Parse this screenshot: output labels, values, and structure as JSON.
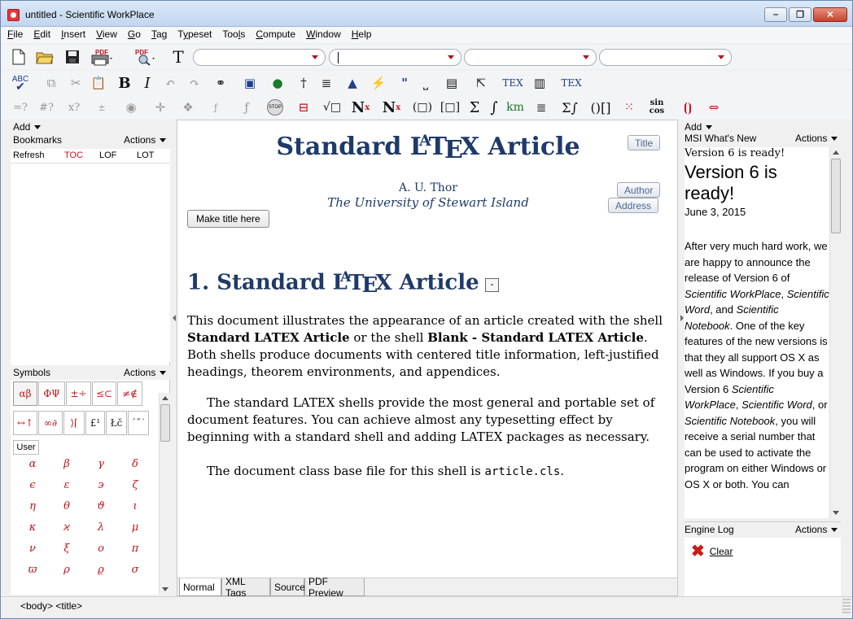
{
  "window": {
    "title": "untitled - Scientific WorkPlace"
  },
  "menu": [
    {
      "pre": "",
      "u": "F",
      "post": "ile"
    },
    {
      "pre": "",
      "u": "E",
      "post": "dit"
    },
    {
      "pre": "",
      "u": "I",
      "post": "nsert"
    },
    {
      "pre": "",
      "u": "V",
      "post": "iew"
    },
    {
      "pre": "",
      "u": "G",
      "post": "o"
    },
    {
      "pre": "",
      "u": "T",
      "post": "ag"
    },
    {
      "pre": "T",
      "u": "y",
      "post": "peset"
    },
    {
      "pre": "Too",
      "u": "l",
      "post": "s"
    },
    {
      "pre": "",
      "u": "C",
      "post": "ompute"
    },
    {
      "pre": "",
      "u": "W",
      "post": "indow"
    },
    {
      "pre": "",
      "u": "H",
      "post": "elp"
    }
  ],
  "toolbar": {
    "pdf_label": "PDF",
    "pdf_label2": "PDF",
    "font_T": "T",
    "spell_label": "ABC",
    "bold": "B",
    "italic": "I",
    "tex1": "TEX",
    "tex2": "TEX",
    "quote": "\"",
    "eval1": "=?",
    "eval2": "#?",
    "eval3": "x?",
    "stop": "STOP",
    "sqrt": "√□",
    "Nx": "N",
    "sup_x": "x",
    "Nsub": "N",
    "sub_x": "x",
    "paren": "(□)",
    "brack": "[□]",
    "sigma": "Σ",
    "integral": "∫",
    "km": "km",
    "sumint": "Σ∫",
    "brackets": "()[]",
    "sin": "sin",
    "cos": "cos"
  },
  "left_panel": {
    "add_label": "Add",
    "bookmarks_label": "Bookmarks",
    "actions_label": "Actions",
    "refresh": "Refresh",
    "toc": "TOC",
    "lof": "LOF",
    "lot": "LOT",
    "symbols_label": "Symbols",
    "symbols_actions": "Actions",
    "symbol_tabs_row1": [
      "αβ",
      "ΦΨ",
      "±÷",
      "≤⊂",
      "≠∉"
    ],
    "symbol_tabs_row2": [
      "↔↑",
      "∞∂",
      "⟩⌈",
      "£¹",
      "Łč",
      "´˝˙"
    ],
    "user_tab": "User",
    "greek": [
      "α",
      "β",
      "γ",
      "δ",
      "ϵ",
      "ε",
      "϶",
      "ζ",
      "η",
      "θ",
      "ϑ",
      "ι",
      "κ",
      "ϰ",
      "λ",
      "μ",
      "ν",
      "ξ",
      "ο",
      "π",
      "ϖ",
      "ρ",
      "ϱ",
      "σ"
    ]
  },
  "document": {
    "title_main": "Standard L",
    "title_a": "A",
    "title_t": "T",
    "title_e": "E",
    "title_x": "X",
    "title_tail": " Article",
    "title_button": "Title",
    "author": "A. U. Thor",
    "affiliation": "The University of Stewart Island",
    "author_button": "Author",
    "address_button": "Address",
    "make_title_button": "Make title here",
    "section_prefix": "1. Standard L",
    "section_tail": " Article",
    "section_box": "-",
    "p1_a": "This document illustrates the appearance of an article created with the shell ",
    "p1_b": "Standard LATEX Article",
    "p1_c": "  or the shell ",
    "p1_d": "Blank - Standard LATEX Article",
    "p1_e": ". Both shells produce documents with centered title information, left-justified headings, theorem environments, and appendices.",
    "p2": "The standard LATEX shells provide the most general and portable set of document features. You can achieve almost any typesetting effect by beginning with a standard shell and adding LATEX packages as necessary.",
    "p3_a": "The document class base file for this shell is ",
    "p3_code": "article.cls",
    "p3_end": ".",
    "tabs": [
      "Normal",
      "XML Tags",
      "Source",
      "PDF Preview"
    ]
  },
  "right_panel": {
    "add_label": "Add",
    "whats_new_label": "MSI What's New",
    "actions_label": "Actions",
    "line1": "Version 6 is ready!",
    "headline": "Version 6 is ready!",
    "date": "June 3, 2015",
    "body_1": "After very much hard work, we are happy to announce the release of Version 6 of ",
    "body_i1": "Scientific WorkPlace",
    "body_2": ", ",
    "body_i2": "Scientific Word",
    "body_3": ", and ",
    "body_i3": "Scientific Notebook",
    "body_4": ". One of the key features of the new versions is that they all support OS X as well as Windows. If you buy a Version 6 ",
    "body_i4": "Scientific WorkPlace",
    "body_5": ", ",
    "body_i5": "Scientific Word",
    "body_6": ", or ",
    "body_i6": "Scientific Notebook",
    "body_7": ", you will receive a serial number that can be used to activate the program on either Windows or OS X or both. You can",
    "engine_log_label": "Engine Log",
    "engine_actions": "Actions",
    "clear_label": "Clear"
  },
  "status": {
    "text": "<body> <title>"
  },
  "colors": {
    "accent": "#1f3a6a",
    "symbol_red": "#c0141c",
    "button_text": "#4c6a99"
  }
}
